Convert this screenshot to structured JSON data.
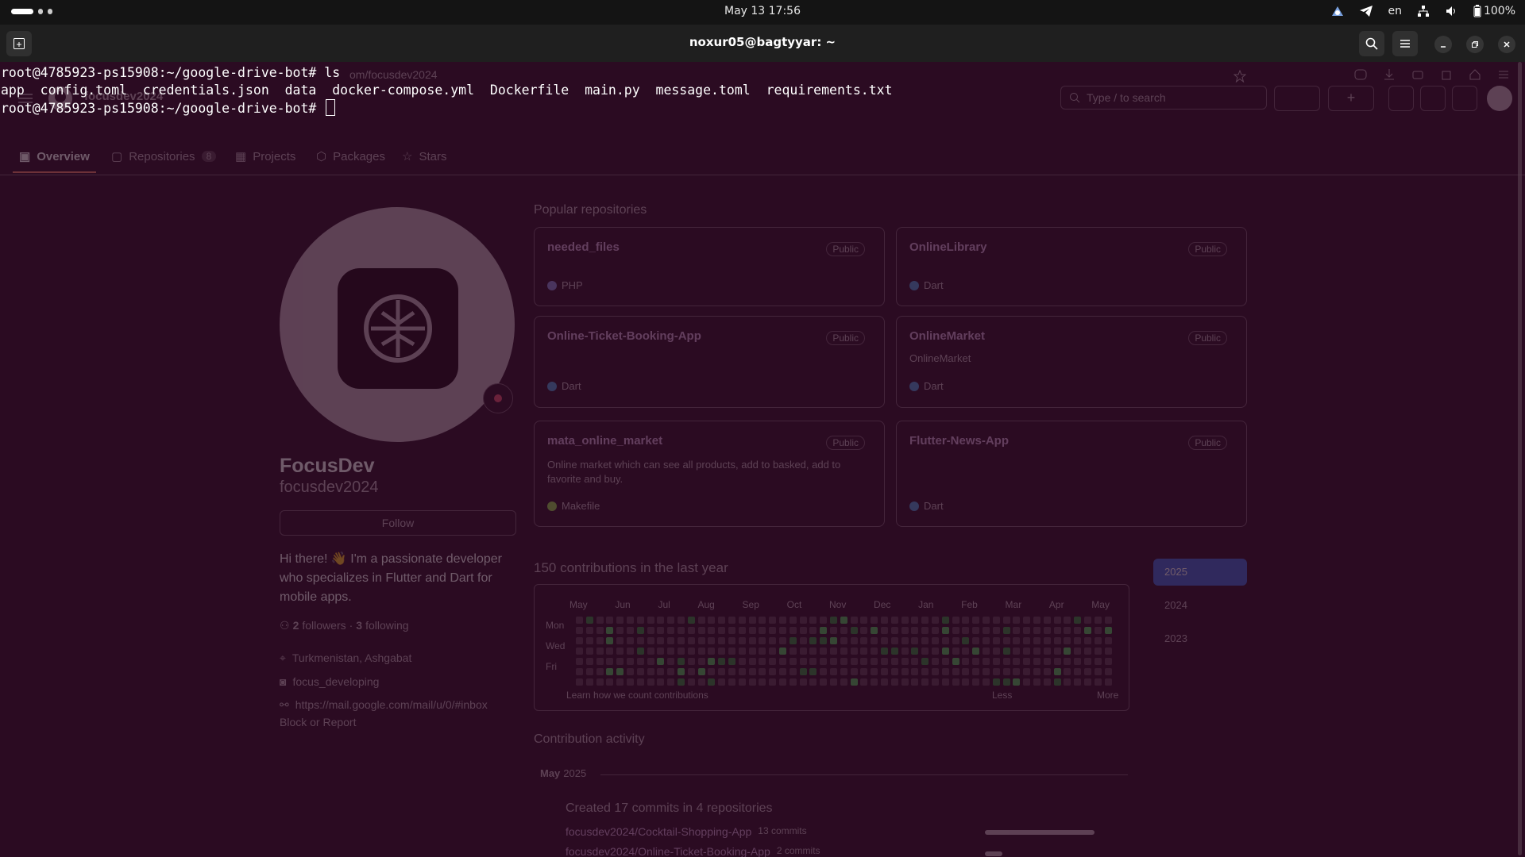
{
  "topbar": {
    "clock": "May 13  17:56",
    "language": "en",
    "battery": "100%"
  },
  "window": {
    "title": "noxur05@bagtyyar: ~"
  },
  "terminal": {
    "line1": "root@4785923-ps15908:~/google-drive-bot# ls",
    "line2": "app  config.toml  credentials.json  data  docker-compose.yml  Dockerfile  main.py  message.toml  requirements.txt",
    "line3": "root@4785923-ps15908:~/google-drive-bot# "
  },
  "github": {
    "url_fragment": "om/focusdev2024",
    "header_username": "focusdev2024",
    "search_placeholder": "Type / to search",
    "tabs": [
      {
        "label": "Overview"
      },
      {
        "label": "Repositories",
        "count": "8"
      },
      {
        "label": "Projects"
      },
      {
        "label": "Packages"
      },
      {
        "label": "Stars"
      }
    ],
    "profile": {
      "name": "FocusDev",
      "username": "focusdev2024",
      "follow_label": "Follow",
      "bio": "Hi there! 👋 I'm a passionate developer who specializes in Flutter and Dart for mobile apps.",
      "followers_count": "2",
      "followers_label": "followers",
      "separator": "·",
      "following_count": "3",
      "following_label": "following",
      "location": "Turkmenistan, Ashgabat",
      "social": "focus_developing",
      "link": "https://mail.google.com/mail/u/0/#inbox",
      "block_label": "Block or Report"
    },
    "popular_title": "Popular repositories",
    "repos": [
      {
        "name": "needed_files",
        "badge": "Public",
        "desc": "",
        "lang": "PHP"
      },
      {
        "name": "OnlineLibrary",
        "badge": "Public",
        "desc": "",
        "lang": "Dart"
      },
      {
        "name": "Online-Ticket-Booking-App",
        "badge": "Public",
        "desc": "",
        "lang": "Dart"
      },
      {
        "name": "OnlineMarket",
        "badge": "Public",
        "desc": "OnlineMarket",
        "lang": "Dart"
      },
      {
        "name": "mata_online_market",
        "badge": "Public",
        "desc": "Online market which can see all products, add to basked, add to favorite and buy.",
        "lang": "Makefile"
      },
      {
        "name": "Flutter-News-App",
        "badge": "Public",
        "desc": "",
        "lang": "Dart"
      }
    ],
    "contrib_title": "150 contributions in the last year",
    "months": [
      "May",
      "Jun",
      "Jul",
      "Aug",
      "Sep",
      "Oct",
      "Nov",
      "Dec",
      "Jan",
      "Feb",
      "Mar",
      "Apr",
      "May"
    ],
    "days": [
      "Mon",
      "Wed",
      "Fri"
    ],
    "learn_label": "Learn how we count contributions",
    "less_label": "Less",
    "more_label": "More",
    "years": [
      "2025",
      "2024",
      "2023"
    ],
    "activity_title": "Contribution activity",
    "activity_month": "May",
    "activity_year": "2025",
    "activity_summary": "Created 17 commits in 4 repositories",
    "activity_items": [
      {
        "repo": "focusdev2024/Cocktail-Shopping-App",
        "commits": "13 commits"
      },
      {
        "repo": "focusdev2024/Online-Ticket-Booking-App",
        "commits": "2 commits"
      }
    ]
  }
}
